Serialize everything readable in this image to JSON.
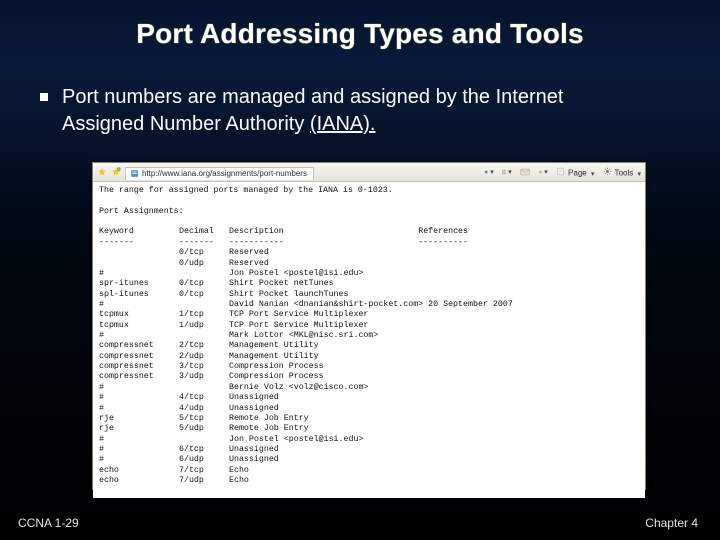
{
  "title": "Port Addressing Types and Tools",
  "bullet_text_1": "Port numbers are managed and assigned by the Internet",
  "bullet_text_2": "Assigned Number Authority ",
  "bullet_iana": "(IANA).",
  "browser": {
    "url_label": "http://www.iana.org/assignments/port-numbers",
    "page_btn": "Page",
    "tools_btn": "Tools"
  },
  "listing": {
    "line_intro": "The range for assigned ports managed by the IANA is 0-1023.",
    "heading": "Port Assignments:",
    "cols": {
      "kw": "Keyword",
      "dec": "Decimal",
      "desc": "Description",
      "ref": "References"
    },
    "rows": [
      {
        "kw": "",
        "dec": "0/tcp",
        "desc": "Reserved",
        "ref": ""
      },
      {
        "kw": "",
        "dec": "0/udp",
        "desc": "Reserved",
        "ref": ""
      },
      {
        "kw": "#",
        "dec": "",
        "desc": "Jon Postel <postel@isi.edu>",
        "ref": ""
      },
      {
        "kw": "spr-itunes",
        "dec": "0/tcp",
        "desc": "Shirt Pocket netTunes",
        "ref": ""
      },
      {
        "kw": "spl-itunes",
        "dec": "0/tcp",
        "desc": "Shirt Pocket launchTunes",
        "ref": ""
      },
      {
        "kw": "#",
        "dec": "",
        "desc": "David Nanian <dnanian&shirt-pocket.com> 20 September 2007",
        "ref": ""
      },
      {
        "kw": "tcpmux",
        "dec": "1/tcp",
        "desc": "TCP Port Service Multiplexer",
        "ref": ""
      },
      {
        "kw": "tcpmux",
        "dec": "1/udp",
        "desc": "TCP Port Service Multiplexer",
        "ref": ""
      },
      {
        "kw": "#",
        "dec": "",
        "desc": "Mark Lottor <MKL@nisc.sri.com>",
        "ref": ""
      },
      {
        "kw": "compressnet",
        "dec": "2/tcp",
        "desc": "Management Utility",
        "ref": ""
      },
      {
        "kw": "compressnet",
        "dec": "2/udp",
        "desc": "Management Utility",
        "ref": ""
      },
      {
        "kw": "compressnet",
        "dec": "3/tcp",
        "desc": "Compression Process",
        "ref": ""
      },
      {
        "kw": "compressnet",
        "dec": "3/udp",
        "desc": "Compression Process",
        "ref": ""
      },
      {
        "kw": "#",
        "dec": "",
        "desc": "Bernie Volz <volz@cisco.com>",
        "ref": ""
      },
      {
        "kw": "#",
        "dec": "4/tcp",
        "desc": "Unassigned",
        "ref": ""
      },
      {
        "kw": "#",
        "dec": "4/udp",
        "desc": "Unassigned",
        "ref": ""
      },
      {
        "kw": "rje",
        "dec": "5/tcp",
        "desc": "Remote Job Entry",
        "ref": ""
      },
      {
        "kw": "rje",
        "dec": "5/udp",
        "desc": "Remote Job Entry",
        "ref": ""
      },
      {
        "kw": "#",
        "dec": "",
        "desc": "Jon Postel <postel@isi.edu>",
        "ref": ""
      },
      {
        "kw": "#",
        "dec": "6/tcp",
        "desc": "Unassigned",
        "ref": ""
      },
      {
        "kw": "#",
        "dec": "6/udp",
        "desc": "Unassigned",
        "ref": ""
      },
      {
        "kw": "echo",
        "dec": "7/tcp",
        "desc": "Echo",
        "ref": ""
      },
      {
        "kw": "echo",
        "dec": "7/udp",
        "desc": "Echo",
        "ref": ""
      }
    ]
  },
  "footer": {
    "left": "CCNA 1-29",
    "right": "Chapter 4"
  }
}
